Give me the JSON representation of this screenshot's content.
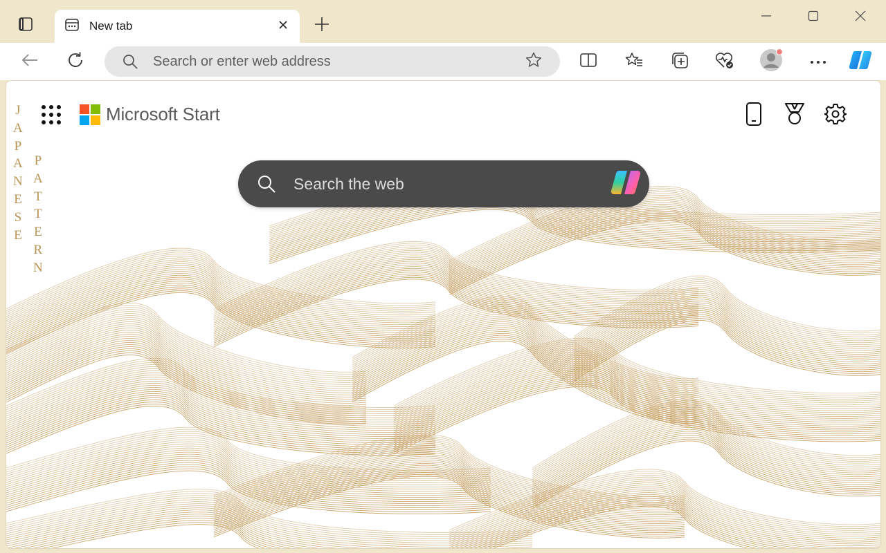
{
  "tab": {
    "title": "New tab"
  },
  "addressbar": {
    "placeholder": "Search or enter web address"
  },
  "page": {
    "brand": "Microsoft Start",
    "search_placeholder": "Search the web",
    "vertical_text": [
      [
        "J",
        "A",
        "P",
        "A",
        "N",
        "E",
        "S",
        "E"
      ],
      [
        "P",
        "A",
        "T",
        "T",
        "E",
        "R",
        "N"
      ]
    ]
  },
  "colors": {
    "titlebar": "#efe6cb",
    "wave_stroke": "#c9a46a",
    "search_bg": "#4a4a4a",
    "ms_red": "#f35325",
    "ms_green": "#81bc06",
    "ms_blue": "#05a6f0",
    "ms_yellow": "#ffba08",
    "profile_dot": "#f47c7c"
  },
  "icons": {
    "tab_actions": "tab-actions-icon",
    "tab_favicon": "new-tab-page-icon",
    "close": "close-icon",
    "new_tab": "plus-icon",
    "back": "back-arrow-icon",
    "refresh": "refresh-icon",
    "favorite": "star-icon",
    "split": "split-screen-icon",
    "favorites": "favorites-icon",
    "collections": "collections-icon",
    "health": "browser-essentials-icon",
    "profile": "profile-avatar-icon",
    "more": "more-icon",
    "copilot": "copilot-icon",
    "apps": "app-launcher-icon",
    "phone": "phone-icon",
    "rewards": "rewards-medal-icon",
    "settings": "gear-icon"
  }
}
